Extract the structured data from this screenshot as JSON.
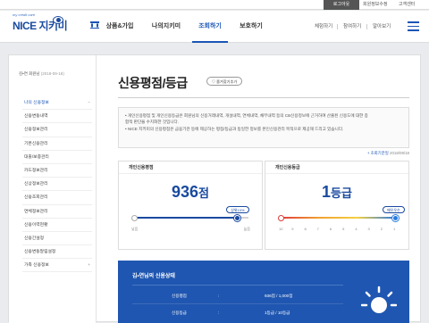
{
  "topbar": {
    "login": "로그아웃",
    "member_service": "회원정보수정",
    "customer_center": "고객센터"
  },
  "logo": {
    "tagline": "my credit care",
    "brand": "NICE 지키미"
  },
  "nav": {
    "products": "상품&가입",
    "my_jikimi": "나의지키미",
    "inquiry": "조회하기",
    "protect": "보호하기"
  },
  "util": {
    "experience": "체험하기",
    "participate": "참여하기",
    "learn": "알아보기"
  },
  "member": {
    "name": "김•연 회원님",
    "date": "(2018-09-18)"
  },
  "sidebar": {
    "items": [
      {
        "label": "나의 신용정보",
        "sign": "−"
      },
      {
        "label": "신용변동내역",
        "sign": ""
      },
      {
        "label": "신용정보관리",
        "sign": ""
      },
      {
        "label": "기본신용관리",
        "sign": ""
      },
      {
        "label": "대출/보증관리",
        "sign": ""
      },
      {
        "label": "카드정보관리",
        "sign": ""
      },
      {
        "label": "신상정보관리",
        "sign": ""
      },
      {
        "label": "신용조회관리",
        "sign": ""
      },
      {
        "label": "연체정보관리",
        "sign": ""
      },
      {
        "label": "신용이력현황",
        "sign": ""
      },
      {
        "label": "신용간설정",
        "sign": ""
      },
      {
        "label": "신용변동알림설정",
        "sign": ""
      },
      {
        "label": "가족 신용정보",
        "sign": "+"
      }
    ]
  },
  "main": {
    "title": "신용평점/등급",
    "fav_label": "즐겨찾기추가",
    "notice": [
      "• 개인신용평점 및 개인신용등급은 회원님의 신용거래내역, 개설내역, 연체내역, 채무내역 등의 CB신용정보에 근거하여 산출된 신용도에 대한 종",
      "  합적 판단을 수치화한 것입니다.",
      "• NICE 지키미의 신용평점은 금융기관 등에 제공하는 평점/등급과 동일한 정보를 본인신용관리 목적으로 제공해 드리고 있습니다."
    ],
    "update_label": "+ 조회기준일 ",
    "update_date": "2018/09/18"
  },
  "score_card": {
    "title": "개인신용평점",
    "value": "936",
    "unit": "점",
    "badge": "상위10%",
    "min_label": "낮음",
    "max_label": "높음",
    "percent": 90
  },
  "grade_card": {
    "title": "개인신용등급",
    "value": "1",
    "unit": "등급",
    "badge": "매우우수",
    "ticks": [
      "10",
      "9",
      "8",
      "7",
      "6",
      "5",
      "4",
      "3",
      "2",
      "1"
    ],
    "level": 1
  },
  "status": {
    "title": "김•연님의 신용상태",
    "rows": [
      {
        "label": "신용평점",
        "colon": ":",
        "value": "936점 / 1,000점"
      },
      {
        "label": "신용등급",
        "colon": ":",
        "value": "1등급 / 10등급"
      }
    ]
  },
  "colors": {
    "brand": "#1a4aa0",
    "accent": "#1a55b5",
    "status_bg": "#1f56b1",
    "grade_low": "#e03a3a",
    "grade_high": "#2a7be0"
  }
}
